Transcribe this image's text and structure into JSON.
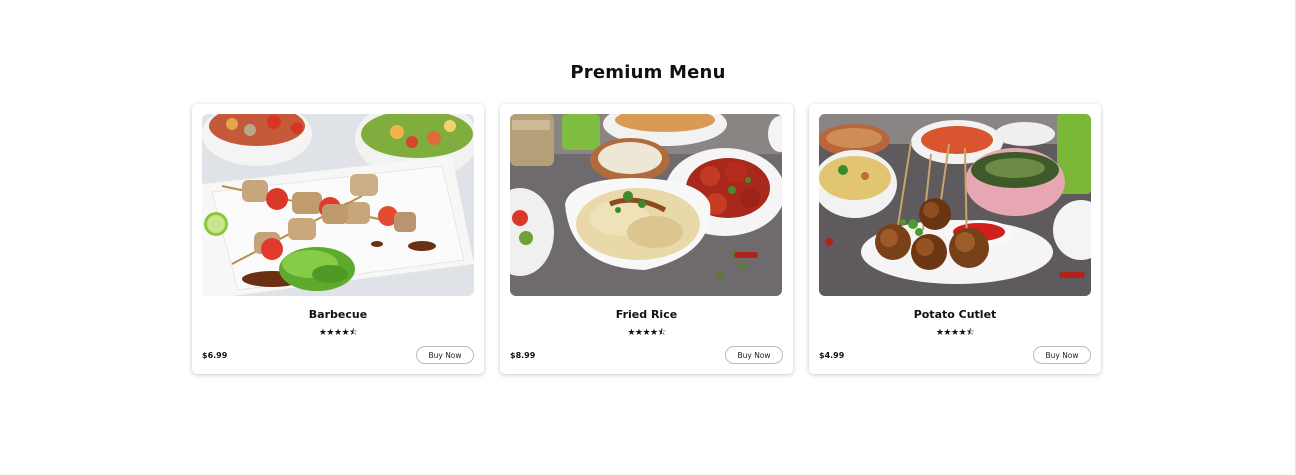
{
  "section": {
    "title": "Premium Menu"
  },
  "cards": [
    {
      "name": "Barbecue",
      "price": "$6.99",
      "rating_text": "★★★★⯪",
      "rating": 4.5,
      "button": "Buy Now"
    },
    {
      "name": "Fried Rice",
      "price": "$8.99",
      "rating_text": "★★★★⯪",
      "rating": 4.5,
      "button": "Buy Now"
    },
    {
      "name": "Potato Cutlet",
      "price": "$4.99",
      "rating_text": "★★★★⯪",
      "rating": 4.5,
      "button": "Buy Now"
    }
  ],
  "colors": {
    "card_shadow": "#d9d9d9",
    "button_border": "#bbbbbb",
    "text": "#111111"
  }
}
